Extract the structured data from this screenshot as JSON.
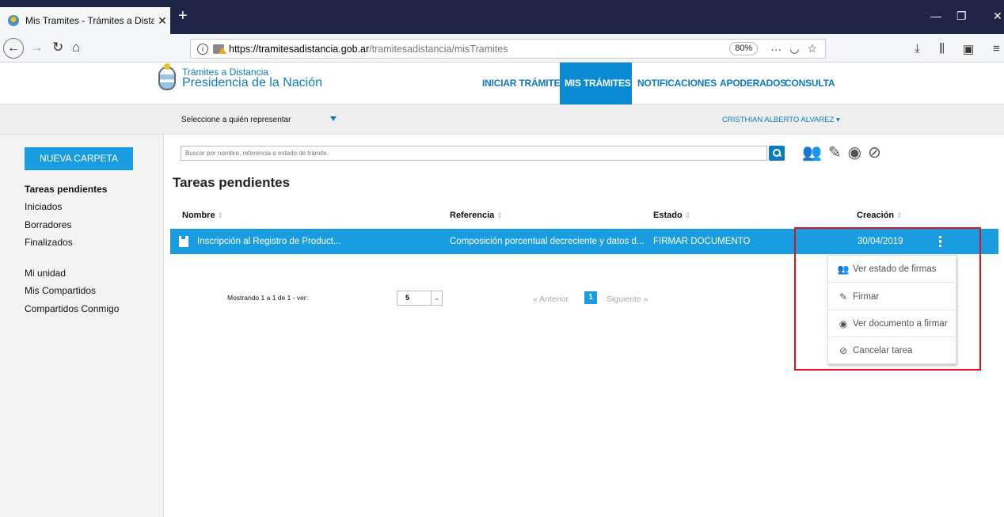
{
  "browser": {
    "tab_title": "Mis Tramites - Trámites a Distar",
    "url_host": "https://tramitesadistancia.gob.ar",
    "url_path": "/tramitesadistancia/misTramites",
    "zoom": "80%"
  },
  "site": {
    "brand_line1": "Trámites a Distancia",
    "brand_line2": "Presidencia de la Nación",
    "nav": [
      "INICIAR TRÁMITE",
      "MIS TRÁMITES",
      "NOTIFICACIONES",
      "APODERADOS",
      "CONSULTA"
    ],
    "represent_label": "Seleccione a quién representar",
    "user_name": "CRISTHIAN ALBERTO ALVAREZ ▾"
  },
  "sidebar": {
    "new_folder": "NUEVA CARPETA",
    "items": [
      "Tareas pendientes",
      "Iniciados",
      "Borradores",
      "Finalizados",
      "Mi unidad",
      "Mis Compartidos",
      "Compartidos Conmigo"
    ]
  },
  "main": {
    "search_placeholder": "Buscar por nombre, referencia o estado de trámite.",
    "title": "Tareas pendientes",
    "columns": [
      "Nombre",
      "Referencia",
      "Estado",
      "Creación"
    ],
    "row": {
      "name": "Inscripción al Registro de Product...",
      "reference": "Composición porcentual decreciente y datos d...",
      "status": "FIRMAR DOCUMENTO",
      "created": "30/04/2019"
    },
    "pager": {
      "info": "Mostrando 1 a 1 de 1 - ver:",
      "page_size": "5",
      "prev": "« Anterior",
      "current": "1",
      "next": "Siguiente »"
    }
  },
  "menu": {
    "items": [
      "Ver estado de firmas",
      "Firmar",
      "Ver documento a firmar",
      "Cancelar tarea"
    ]
  },
  "colors": {
    "accent": "#1a9de0",
    "highlight": "#e4111d"
  }
}
